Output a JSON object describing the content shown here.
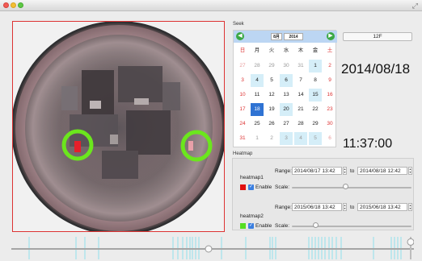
{
  "window": {
    "resize_icon": "resize-icon"
  },
  "seek": {
    "label": "Seek",
    "calendar": {
      "month": "8月",
      "year": "2014",
      "prev_icon": "arrow-left-icon",
      "next_icon": "arrow-right-icon",
      "weekdays": [
        "日",
        "月",
        "火",
        "水",
        "木",
        "金",
        "土"
      ],
      "rows": [
        [
          "27",
          "28",
          "29",
          "30",
          "31",
          "1",
          "2"
        ],
        [
          "3",
          "4",
          "5",
          "6",
          "7",
          "8",
          "9"
        ],
        [
          "10",
          "11",
          "12",
          "13",
          "14",
          "15",
          "16"
        ],
        [
          "17",
          "18",
          "19",
          "20",
          "21",
          "22",
          "23"
        ],
        [
          "24",
          "25",
          "26",
          "27",
          "28",
          "29",
          "30"
        ],
        [
          "31",
          "1",
          "2",
          "3",
          "4",
          "5",
          "6"
        ]
      ],
      "selected_day": "18"
    },
    "button_label": "12F",
    "date": "2014/08/18",
    "time": "11:37:00"
  },
  "heatmap": {
    "label": "Heatmap",
    "items": [
      {
        "name": "heatmap1",
        "range_label": "Range:",
        "from": "2014/08/17 13:42",
        "to_label": "to",
        "to": "2014/08/18 12:42",
        "enable_label": "Enable",
        "scale_label": "Scale:",
        "color": "#e01010",
        "enabled": true,
        "scale_value": 0.45
      },
      {
        "name": "heatmap2",
        "range_label": "Range:",
        "from": "2015/06/18 13:42",
        "to_label": "to",
        "to": "2015/06/18 13:42",
        "enable_label": "Enable",
        "scale_label": "Scale:",
        "color": "#55dd22",
        "enabled": true,
        "scale_value": 0.2
      }
    ]
  },
  "timeline": {
    "position": 0.5,
    "volume_level": 0.9
  }
}
